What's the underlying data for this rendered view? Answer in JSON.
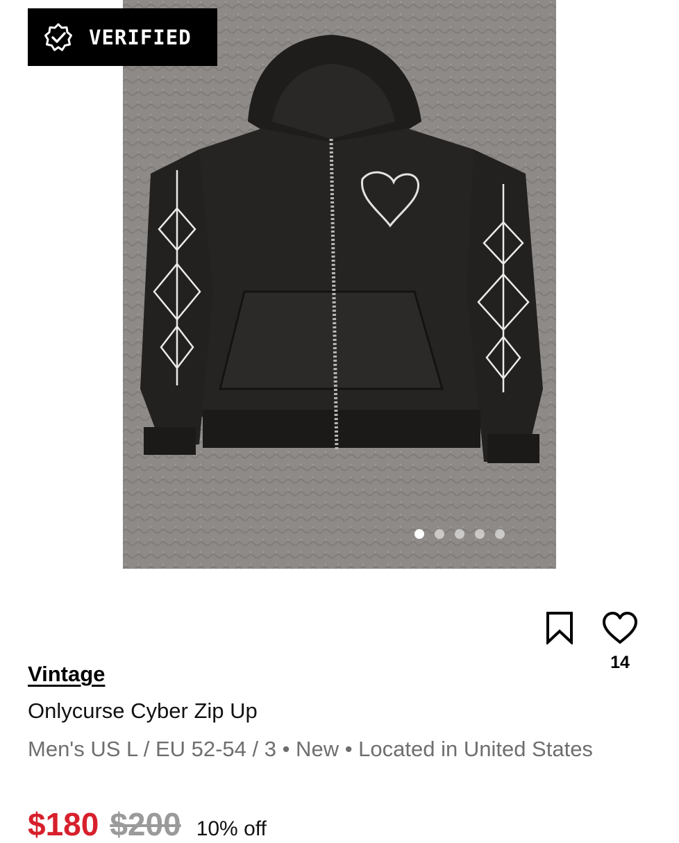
{
  "badge": {
    "label": "VERIFIED",
    "icon": "verified-check-icon"
  },
  "gallery": {
    "image_count": 5,
    "active_index": 0
  },
  "actions": {
    "save_icon": "bookmark-icon",
    "like_icon": "heart-icon",
    "like_count": "14"
  },
  "listing": {
    "brand": "Vintage",
    "title": "Onlycurse Cyber Zip Up",
    "meta": "Men's US L / EU 52-54 / 3 • New • Located in United States",
    "price": "$180",
    "original_price": "$200",
    "discount": "10% off"
  },
  "colors": {
    "price_red": "#d7202c",
    "meta_gray": "#6e6e6e",
    "badge_bg": "#000000"
  }
}
